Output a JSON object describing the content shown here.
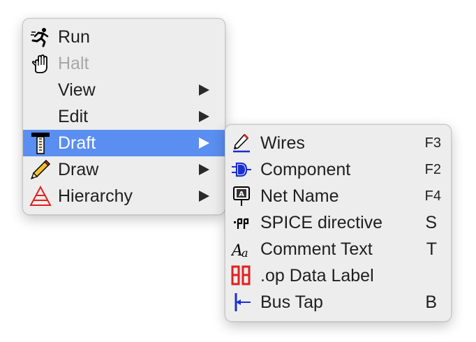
{
  "main_menu": {
    "items": [
      {
        "label": "Run",
        "icon": "running-man-icon",
        "enabled": true,
        "submenu": false
      },
      {
        "label": "Halt",
        "icon": "halt-hand-icon",
        "enabled": false,
        "submenu": false
      },
      {
        "label": "View",
        "icon": null,
        "enabled": true,
        "submenu": true
      },
      {
        "label": "Edit",
        "icon": null,
        "enabled": true,
        "submenu": true
      },
      {
        "label": "Draft",
        "icon": "t-square-icon",
        "enabled": true,
        "submenu": true,
        "selected": true
      },
      {
        "label": "Draw",
        "icon": "pencil-icon",
        "enabled": true,
        "submenu": true
      },
      {
        "label": "Hierarchy",
        "icon": "hierarchy-triangle-icon",
        "enabled": true,
        "submenu": true
      }
    ]
  },
  "draft_submenu": {
    "items": [
      {
        "label": "Wires",
        "icon": "wire-pencil-icon",
        "shortcut": "F3"
      },
      {
        "label": "Component",
        "icon": "component-gate-icon",
        "shortcut": "F2"
      },
      {
        "label": "Net Name",
        "icon": "net-name-label-icon",
        "shortcut": "F4"
      },
      {
        "label": "SPICE directive",
        "icon": "spice-directive-icon",
        "shortcut": "S"
      },
      {
        "label": "Comment Text",
        "icon": "comment-text-icon",
        "shortcut": "T"
      },
      {
        "label": ".op Data Label",
        "icon": "op-data-label-icon",
        "shortcut": ""
      },
      {
        "label": "Bus Tap",
        "icon": "bus-tap-icon",
        "shortcut": "B"
      }
    ]
  },
  "colors": {
    "selection": "#5a8ef0",
    "menu_background": "#ededed",
    "disabled_text": "#a8a8a8",
    "icon_red": "#e02020",
    "icon_blue": "#1a2fd0"
  }
}
